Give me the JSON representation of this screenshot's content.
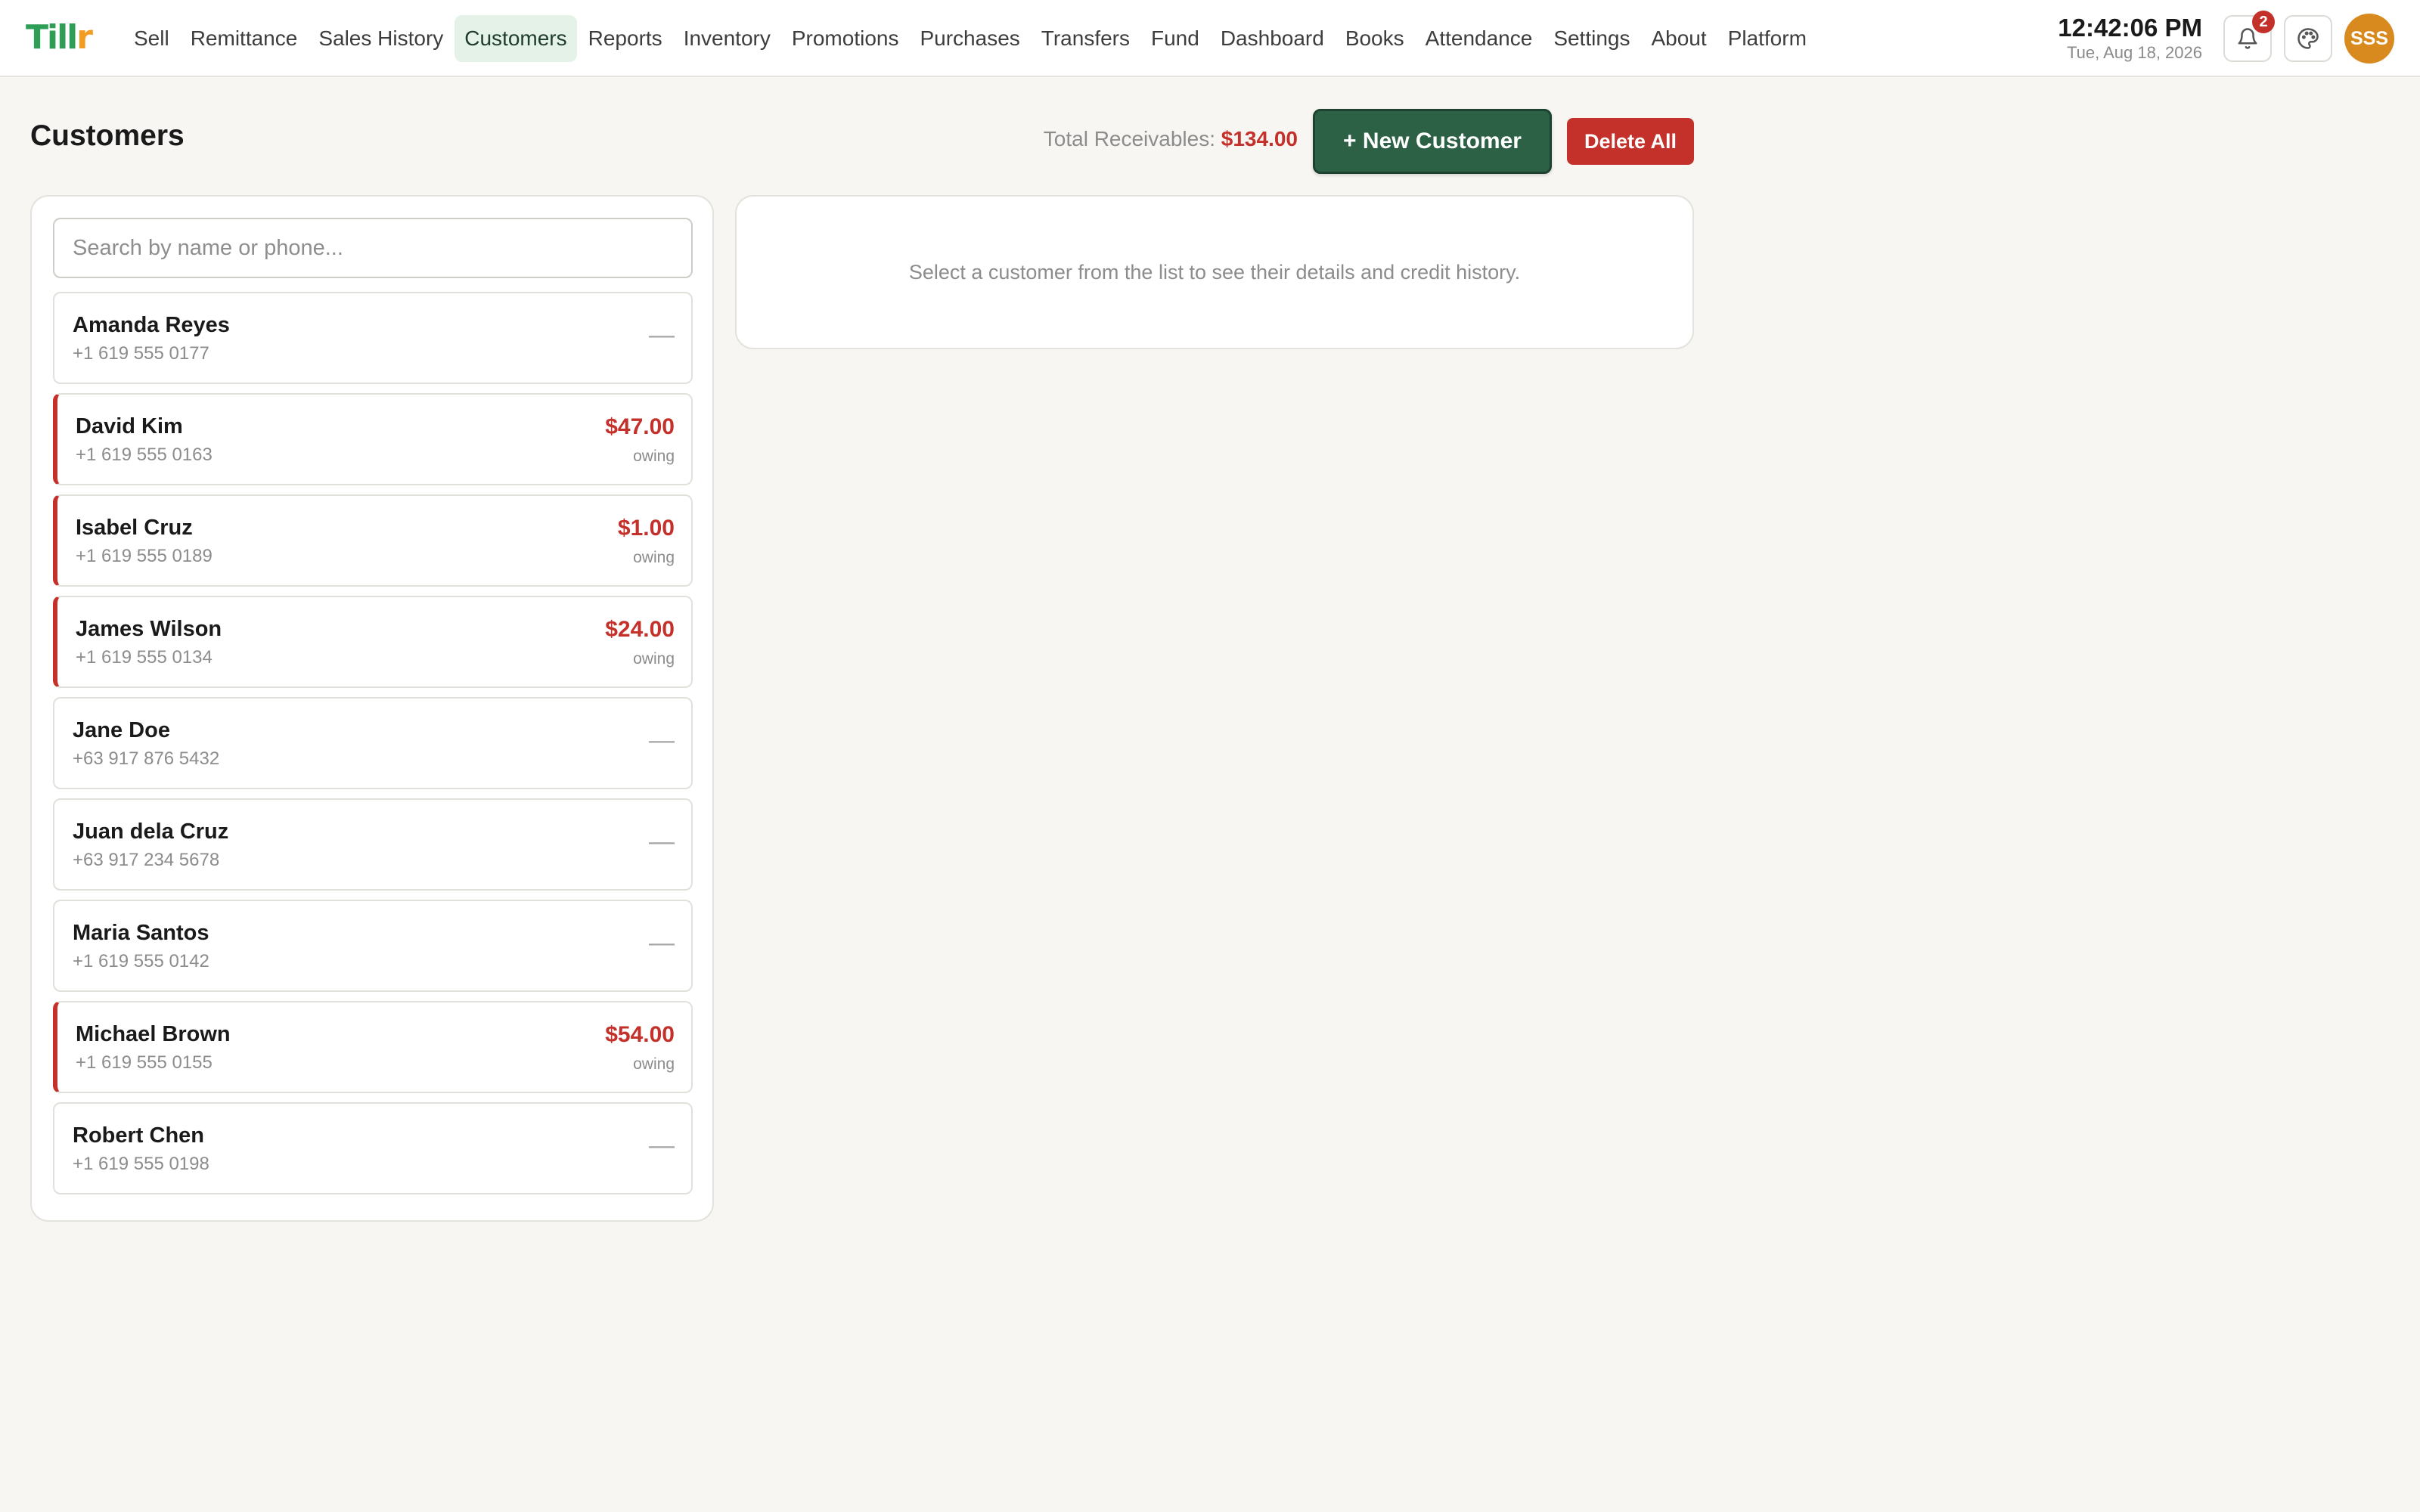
{
  "app": {
    "logo_main": "Till",
    "logo_accent": "r"
  },
  "nav": {
    "items": [
      {
        "label": "Sell"
      },
      {
        "label": "Remittance"
      },
      {
        "label": "Sales History"
      },
      {
        "label": "Customers",
        "active": true
      },
      {
        "label": "Reports"
      },
      {
        "label": "Inventory"
      },
      {
        "label": "Promotions"
      },
      {
        "label": "Purchases"
      },
      {
        "label": "Transfers"
      },
      {
        "label": "Fund"
      },
      {
        "label": "Dashboard"
      },
      {
        "label": "Books"
      },
      {
        "label": "Attendance"
      },
      {
        "label": "Settings"
      },
      {
        "label": "About"
      },
      {
        "label": "Platform"
      }
    ]
  },
  "header": {
    "time": "12:42:06 PM",
    "date": "Tue, Aug 18, 2026",
    "notification_count": "2",
    "avatar_initials": "SSS",
    "icons": {
      "notifications": "bell-icon",
      "theme": "palette-icon"
    }
  },
  "page": {
    "title": "Customers",
    "receivables_label": "Total Receivables:",
    "receivables_amount": "$134.00",
    "new_customer_label": "+ New Customer",
    "delete_all_label": "Delete All"
  },
  "search": {
    "placeholder": "Search by name or phone..."
  },
  "customers": [
    {
      "name": "Amanda Reyes",
      "phone": "+1 619 555 0177",
      "balance": "—",
      "owing": false
    },
    {
      "name": "David Kim",
      "phone": "+1 619 555 0163",
      "balance": "$47.00",
      "owing": true,
      "owing_label": "owing"
    },
    {
      "name": "Isabel Cruz",
      "phone": "+1 619 555 0189",
      "balance": "$1.00",
      "owing": true,
      "owing_label": "owing"
    },
    {
      "name": "James Wilson",
      "phone": "+1 619 555 0134",
      "balance": "$24.00",
      "owing": true,
      "owing_label": "owing"
    },
    {
      "name": "Jane Doe",
      "phone": "+63 917 876 5432",
      "balance": "—",
      "owing": false
    },
    {
      "name": "Juan dela Cruz",
      "phone": "+63 917 234 5678",
      "balance": "—",
      "owing": false
    },
    {
      "name": "Maria Santos",
      "phone": "+1 619 555 0142",
      "balance": "—",
      "owing": false
    },
    {
      "name": "Michael Brown",
      "phone": "+1 619 555 0155",
      "balance": "$54.00",
      "owing": true,
      "owing_label": "owing"
    },
    {
      "name": "Robert Chen",
      "phone": "+1 619 555 0198",
      "balance": "—",
      "owing": false
    }
  ],
  "detail": {
    "hint": "Select a customer from the list to see their details and credit history."
  },
  "colors": {
    "brand_green": "#2e9e57",
    "brand_orange": "#f39c23",
    "primary": "#2c6146",
    "danger": "#c4312b",
    "avatar": "#d98a1f"
  }
}
